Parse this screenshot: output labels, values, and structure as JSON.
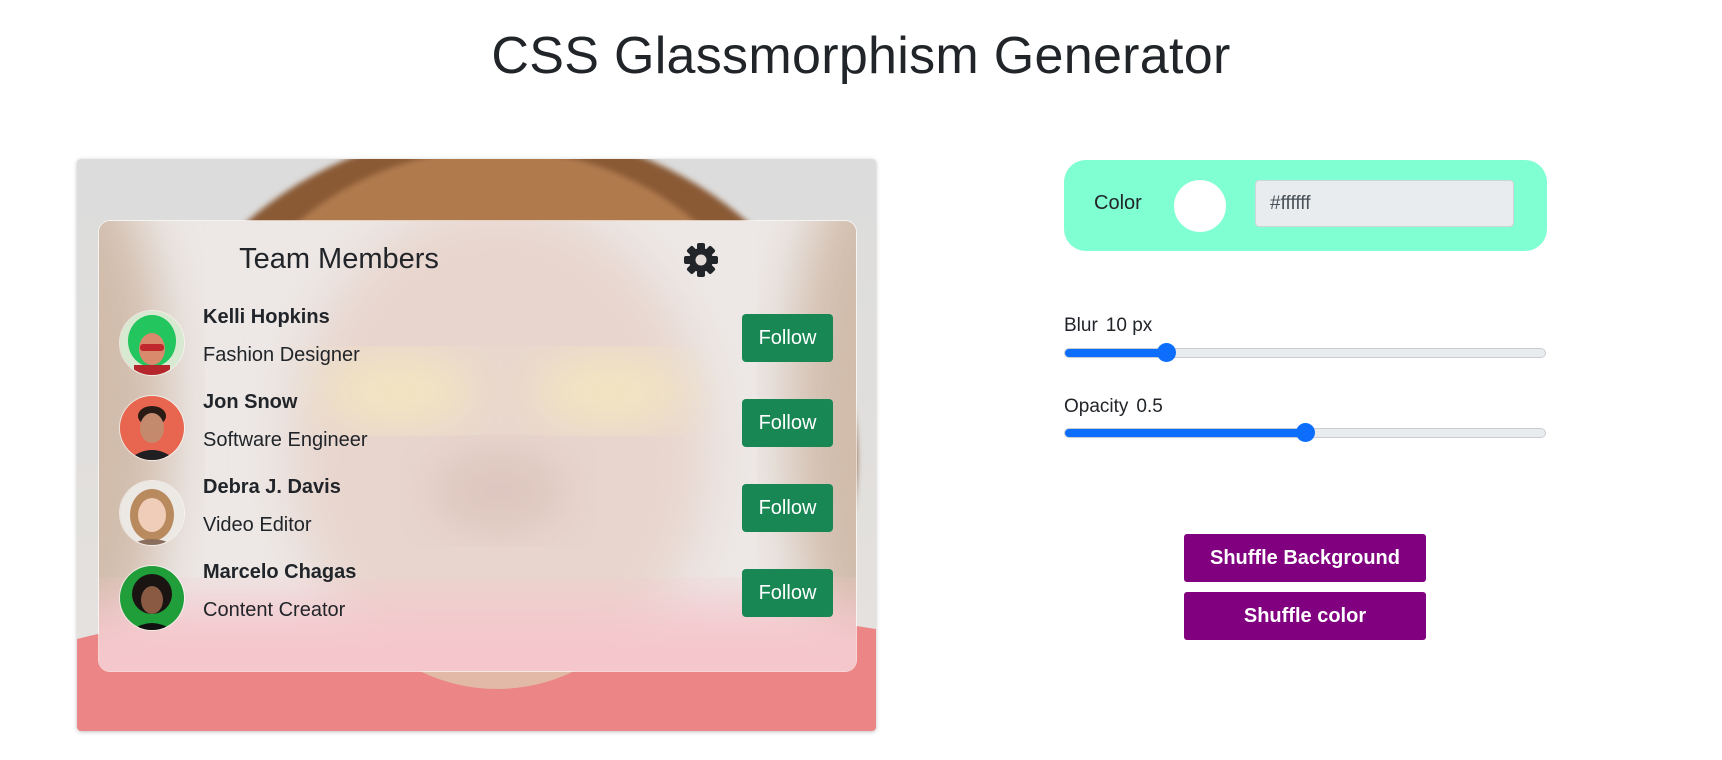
{
  "page": {
    "title": "CSS Glassmorphism Generator"
  },
  "card": {
    "title": "Team Members",
    "settings_icon": "gear-icon",
    "members": [
      {
        "name": "Kelli Hopkins",
        "role": "Fashion Designer",
        "button": "Follow",
        "avatar_color": "#2ecc71"
      },
      {
        "name": "Jon Snow",
        "role": "Software Engineer",
        "button": "Follow",
        "avatar_color": "#e8664f"
      },
      {
        "name": "Debra J. Davis",
        "role": "Video Editor",
        "button": "Follow",
        "avatar_color": "#d8c4b4"
      },
      {
        "name": "Marcelo Chagas",
        "role": "Content Creator",
        "button": "Follow",
        "avatar_color": "#1f9e3a"
      }
    ]
  },
  "controls": {
    "color": {
      "label": "Color",
      "value": "#ffffff",
      "panel_color": "#80ffd3"
    },
    "blur": {
      "label": "Blur",
      "value": "10 px",
      "fraction": 0.21
    },
    "opacity": {
      "label": "Opacity",
      "value": "0.5",
      "fraction": 0.5
    },
    "shuffle_background": "Shuffle Background",
    "shuffle_color": "Shuffle color"
  },
  "colors": {
    "follow": "#198754",
    "purple": "#800080",
    "slider": "#0d6efd"
  }
}
